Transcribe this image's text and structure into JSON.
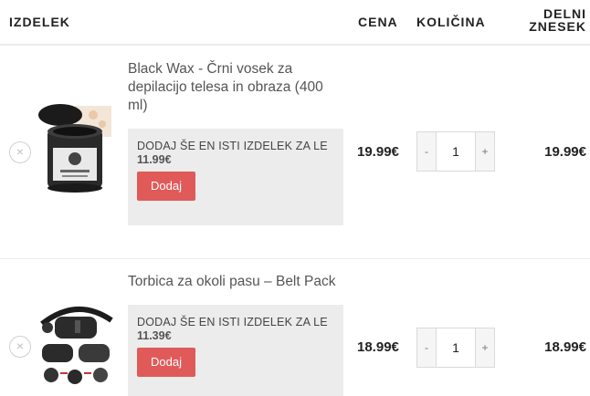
{
  "header": {
    "product": "IZDELEK",
    "price": "CENA",
    "quantity": "KOLIČINA",
    "subtotal_line1": "DELNI",
    "subtotal_line2": "ZNESEK"
  },
  "items": [
    {
      "name": "Black Wax - Črni vosek za depilacijo telesa in obraza (400 ml)",
      "upsell_text": "DODAJ ŠE EN ISTI IZDELEK ZA LE",
      "upsell_price": "11.99€",
      "add_label": "Dodaj",
      "price": "19.99€",
      "quantity": "1",
      "subtotal": "19.99€",
      "remove_icon": "×",
      "image": "black-wax-jar"
    },
    {
      "name": "Torbica za okoli pasu – Belt Pack",
      "upsell_text": "DODAJ ŠE EN ISTI IZDELEK ZA LE",
      "upsell_price": "11.39€",
      "add_label": "Dodaj",
      "price": "18.99€",
      "quantity": "1",
      "subtotal": "18.99€",
      "remove_icon": "×",
      "image": "belt-pack"
    }
  ],
  "qty_controls": {
    "minus": "-",
    "plus": "+"
  },
  "colors": {
    "accent": "#e05a5a",
    "upsell_bg": "#ececec"
  }
}
